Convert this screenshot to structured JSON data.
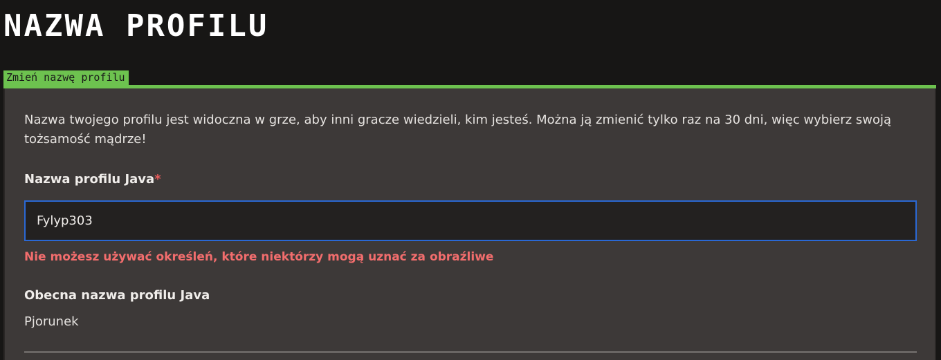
{
  "header": {
    "title": "NAZWA PROFILU"
  },
  "section": {
    "tab_label": "Zmień nazwę profilu",
    "description": "Nazwa twojego profilu jest widoczna w grze, aby inni gracze wiedzieli, kim jesteś. Można ją zmienić tylko raz na 30 dni, więc wybierz swoją tożsamość mądrze!"
  },
  "form": {
    "field_label": "Nazwa profilu Java",
    "required_marker": "*",
    "input_value": "Fylyp303",
    "error_message": "Nie możesz używać określeń, które niektórzy mogą uznać za obraźliwe",
    "current_label": "Obecna nazwa profilu Java",
    "current_value": "Pjorunek"
  },
  "colors": {
    "accent_green": "#6dc24f",
    "focus_blue": "#2a68d4",
    "error_red": "#f26d6d",
    "panel_bg": "#3d3938",
    "page_bg": "#171615"
  }
}
